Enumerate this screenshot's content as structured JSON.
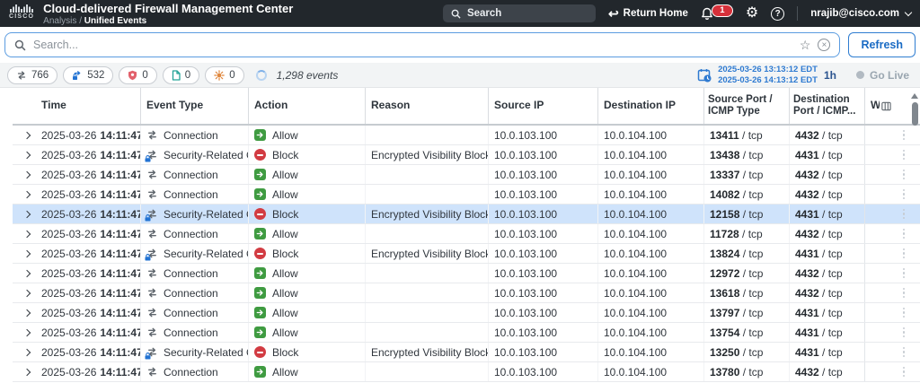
{
  "header": {
    "brand": "CISCO",
    "title": "Cloud-delivered Firewall Management Center",
    "breadcrumb_section": "Analysis",
    "breadcrumb_separator": " / ",
    "breadcrumb_page": "Unified Events",
    "search_label": "Search",
    "return_home_label": "Return Home",
    "notification_count": "1",
    "user_email": "nrajib@cisco.com"
  },
  "toolbar": {
    "search_placeholder": "Search...",
    "refresh_label": "Refresh"
  },
  "filters": {
    "chips": [
      {
        "name": "connection-events",
        "icon": "swap-arrows-icon",
        "count": "766",
        "color": "#5d646b"
      },
      {
        "name": "security-related-connection-events",
        "icon": "secure-connection-icon",
        "count": "532",
        "color": "#2273d3"
      },
      {
        "name": "intrusion-events",
        "icon": "shield-icon",
        "count": "0",
        "color": "#e2606b"
      },
      {
        "name": "file-events",
        "icon": "file-icon",
        "count": "0",
        "color": "#23a397"
      },
      {
        "name": "malware-events",
        "icon": "malware-icon",
        "count": "0",
        "color": "#e0883f"
      }
    ],
    "events_count": "1,298 events",
    "time_range": {
      "start": "2025-03-26 13:13:12 EDT",
      "end": "2025-03-26 14:13:12 EDT",
      "duration_label": "1h"
    },
    "go_live_label": "Go Live"
  },
  "table": {
    "columns": [
      "Time",
      "Event Type",
      "Action",
      "Reason",
      "Source IP",
      "Destination IP",
      "Source Port / ICMP Type",
      "Destination Port / ICMP...",
      "W"
    ],
    "rows": [
      {
        "date": "2025-03-26",
        "time": "14:11:47",
        "event_type": "Connection",
        "action": "Allow",
        "reason": "",
        "src_ip": "10.0.103.100",
        "dst_ip": "10.0.104.100",
        "src_port": "13411",
        "src_proto": "tcp",
        "dst_port": "4432",
        "dst_proto": "tcp",
        "highlighted": false
      },
      {
        "date": "2025-03-26",
        "time": "14:11:47",
        "event_type": "Security-Related Connection",
        "action": "Block",
        "reason": "Encrypted Visibility Block",
        "src_ip": "10.0.103.100",
        "dst_ip": "10.0.104.100",
        "src_port": "13438",
        "src_proto": "tcp",
        "dst_port": "4431",
        "dst_proto": "tcp",
        "highlighted": false
      },
      {
        "date": "2025-03-26",
        "time": "14:11:47",
        "event_type": "Connection",
        "action": "Allow",
        "reason": "",
        "src_ip": "10.0.103.100",
        "dst_ip": "10.0.104.100",
        "src_port": "13337",
        "src_proto": "tcp",
        "dst_port": "4432",
        "dst_proto": "tcp",
        "highlighted": false
      },
      {
        "date": "2025-03-26",
        "time": "14:11:47",
        "event_type": "Connection",
        "action": "Allow",
        "reason": "",
        "src_ip": "10.0.103.100",
        "dst_ip": "10.0.104.100",
        "src_port": "14082",
        "src_proto": "tcp",
        "dst_port": "4432",
        "dst_proto": "tcp",
        "highlighted": false
      },
      {
        "date": "2025-03-26",
        "time": "14:11:47",
        "event_type": "Security-Related Connection",
        "action": "Block",
        "reason": "Encrypted Visibility Block",
        "src_ip": "10.0.103.100",
        "dst_ip": "10.0.104.100",
        "src_port": "12158",
        "src_proto": "tcp",
        "dst_port": "4431",
        "dst_proto": "tcp",
        "highlighted": true
      },
      {
        "date": "2025-03-26",
        "time": "14:11:47",
        "event_type": "Connection",
        "action": "Allow",
        "reason": "",
        "src_ip": "10.0.103.100",
        "dst_ip": "10.0.104.100",
        "src_port": "11728",
        "src_proto": "tcp",
        "dst_port": "4432",
        "dst_proto": "tcp",
        "highlighted": false
      },
      {
        "date": "2025-03-26",
        "time": "14:11:47",
        "event_type": "Security-Related Connection",
        "action": "Block",
        "reason": "Encrypted Visibility Block",
        "src_ip": "10.0.103.100",
        "dst_ip": "10.0.104.100",
        "src_port": "13824",
        "src_proto": "tcp",
        "dst_port": "4431",
        "dst_proto": "tcp",
        "highlighted": false
      },
      {
        "date": "2025-03-26",
        "time": "14:11:47",
        "event_type": "Connection",
        "action": "Allow",
        "reason": "",
        "src_ip": "10.0.103.100",
        "dst_ip": "10.0.104.100",
        "src_port": "12972",
        "src_proto": "tcp",
        "dst_port": "4432",
        "dst_proto": "tcp",
        "highlighted": false
      },
      {
        "date": "2025-03-26",
        "time": "14:11:47",
        "event_type": "Connection",
        "action": "Allow",
        "reason": "",
        "src_ip": "10.0.103.100",
        "dst_ip": "10.0.104.100",
        "src_port": "13618",
        "src_proto": "tcp",
        "dst_port": "4432",
        "dst_proto": "tcp",
        "highlighted": false
      },
      {
        "date": "2025-03-26",
        "time": "14:11:47",
        "event_type": "Connection",
        "action": "Allow",
        "reason": "",
        "src_ip": "10.0.103.100",
        "dst_ip": "10.0.104.100",
        "src_port": "13797",
        "src_proto": "tcp",
        "dst_port": "4431",
        "dst_proto": "tcp",
        "highlighted": false
      },
      {
        "date": "2025-03-26",
        "time": "14:11:47",
        "event_type": "Connection",
        "action": "Allow",
        "reason": "",
        "src_ip": "10.0.103.100",
        "dst_ip": "10.0.104.100",
        "src_port": "13754",
        "src_proto": "tcp",
        "dst_port": "4431",
        "dst_proto": "tcp",
        "highlighted": false
      },
      {
        "date": "2025-03-26",
        "time": "14:11:47",
        "event_type": "Security-Related Connection",
        "action": "Block",
        "reason": "Encrypted Visibility Block",
        "src_ip": "10.0.103.100",
        "dst_ip": "10.0.104.100",
        "src_port": "13250",
        "src_proto": "tcp",
        "dst_port": "4431",
        "dst_proto": "tcp",
        "highlighted": false
      },
      {
        "date": "2025-03-26",
        "time": "14:11:47",
        "event_type": "Connection",
        "action": "Allow",
        "reason": "",
        "src_ip": "10.0.103.100",
        "dst_ip": "10.0.104.100",
        "src_port": "13780",
        "src_proto": "tcp",
        "dst_port": "4432",
        "dst_proto": "tcp",
        "highlighted": false
      }
    ]
  }
}
